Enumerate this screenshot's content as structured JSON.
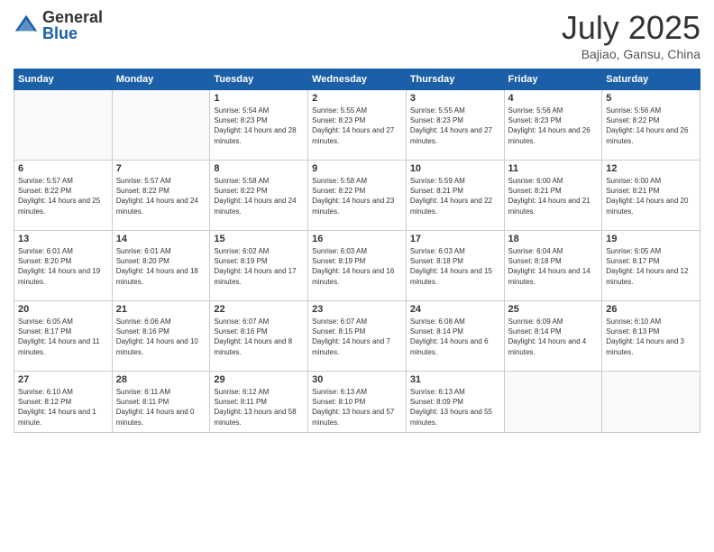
{
  "header": {
    "logo_general": "General",
    "logo_blue": "Blue",
    "month_title": "July 2025",
    "location": "Bajiao, Gansu, China"
  },
  "days_of_week": [
    "Sunday",
    "Monday",
    "Tuesday",
    "Wednesday",
    "Thursday",
    "Friday",
    "Saturday"
  ],
  "weeks": [
    [
      {
        "day": "",
        "info": ""
      },
      {
        "day": "",
        "info": ""
      },
      {
        "day": "1",
        "info": "Sunrise: 5:54 AM\nSunset: 8:23 PM\nDaylight: 14 hours and 28 minutes."
      },
      {
        "day": "2",
        "info": "Sunrise: 5:55 AM\nSunset: 8:23 PM\nDaylight: 14 hours and 27 minutes."
      },
      {
        "day": "3",
        "info": "Sunrise: 5:55 AM\nSunset: 8:23 PM\nDaylight: 14 hours and 27 minutes."
      },
      {
        "day": "4",
        "info": "Sunrise: 5:56 AM\nSunset: 8:23 PM\nDaylight: 14 hours and 26 minutes."
      },
      {
        "day": "5",
        "info": "Sunrise: 5:56 AM\nSunset: 8:22 PM\nDaylight: 14 hours and 26 minutes."
      }
    ],
    [
      {
        "day": "6",
        "info": "Sunrise: 5:57 AM\nSunset: 8:22 PM\nDaylight: 14 hours and 25 minutes."
      },
      {
        "day": "7",
        "info": "Sunrise: 5:57 AM\nSunset: 8:22 PM\nDaylight: 14 hours and 24 minutes."
      },
      {
        "day": "8",
        "info": "Sunrise: 5:58 AM\nSunset: 8:22 PM\nDaylight: 14 hours and 24 minutes."
      },
      {
        "day": "9",
        "info": "Sunrise: 5:58 AM\nSunset: 8:22 PM\nDaylight: 14 hours and 23 minutes."
      },
      {
        "day": "10",
        "info": "Sunrise: 5:59 AM\nSunset: 8:21 PM\nDaylight: 14 hours and 22 minutes."
      },
      {
        "day": "11",
        "info": "Sunrise: 6:00 AM\nSunset: 8:21 PM\nDaylight: 14 hours and 21 minutes."
      },
      {
        "day": "12",
        "info": "Sunrise: 6:00 AM\nSunset: 8:21 PM\nDaylight: 14 hours and 20 minutes."
      }
    ],
    [
      {
        "day": "13",
        "info": "Sunrise: 6:01 AM\nSunset: 8:20 PM\nDaylight: 14 hours and 19 minutes."
      },
      {
        "day": "14",
        "info": "Sunrise: 6:01 AM\nSunset: 8:20 PM\nDaylight: 14 hours and 18 minutes."
      },
      {
        "day": "15",
        "info": "Sunrise: 6:02 AM\nSunset: 8:19 PM\nDaylight: 14 hours and 17 minutes."
      },
      {
        "day": "16",
        "info": "Sunrise: 6:03 AM\nSunset: 8:19 PM\nDaylight: 14 hours and 16 minutes."
      },
      {
        "day": "17",
        "info": "Sunrise: 6:03 AM\nSunset: 8:18 PM\nDaylight: 14 hours and 15 minutes."
      },
      {
        "day": "18",
        "info": "Sunrise: 6:04 AM\nSunset: 8:18 PM\nDaylight: 14 hours and 14 minutes."
      },
      {
        "day": "19",
        "info": "Sunrise: 6:05 AM\nSunset: 8:17 PM\nDaylight: 14 hours and 12 minutes."
      }
    ],
    [
      {
        "day": "20",
        "info": "Sunrise: 6:05 AM\nSunset: 8:17 PM\nDaylight: 14 hours and 11 minutes."
      },
      {
        "day": "21",
        "info": "Sunrise: 6:06 AM\nSunset: 8:16 PM\nDaylight: 14 hours and 10 minutes."
      },
      {
        "day": "22",
        "info": "Sunrise: 6:07 AM\nSunset: 8:16 PM\nDaylight: 14 hours and 8 minutes."
      },
      {
        "day": "23",
        "info": "Sunrise: 6:07 AM\nSunset: 8:15 PM\nDaylight: 14 hours and 7 minutes."
      },
      {
        "day": "24",
        "info": "Sunrise: 6:08 AM\nSunset: 8:14 PM\nDaylight: 14 hours and 6 minutes."
      },
      {
        "day": "25",
        "info": "Sunrise: 6:09 AM\nSunset: 8:14 PM\nDaylight: 14 hours and 4 minutes."
      },
      {
        "day": "26",
        "info": "Sunrise: 6:10 AM\nSunset: 8:13 PM\nDaylight: 14 hours and 3 minutes."
      }
    ],
    [
      {
        "day": "27",
        "info": "Sunrise: 6:10 AM\nSunset: 8:12 PM\nDaylight: 14 hours and 1 minute."
      },
      {
        "day": "28",
        "info": "Sunrise: 6:11 AM\nSunset: 8:11 PM\nDaylight: 14 hours and 0 minutes."
      },
      {
        "day": "29",
        "info": "Sunrise: 6:12 AM\nSunset: 8:11 PM\nDaylight: 13 hours and 58 minutes."
      },
      {
        "day": "30",
        "info": "Sunrise: 6:13 AM\nSunset: 8:10 PM\nDaylight: 13 hours and 57 minutes."
      },
      {
        "day": "31",
        "info": "Sunrise: 6:13 AM\nSunset: 8:09 PM\nDaylight: 13 hours and 55 minutes."
      },
      {
        "day": "",
        "info": ""
      },
      {
        "day": "",
        "info": ""
      }
    ]
  ]
}
